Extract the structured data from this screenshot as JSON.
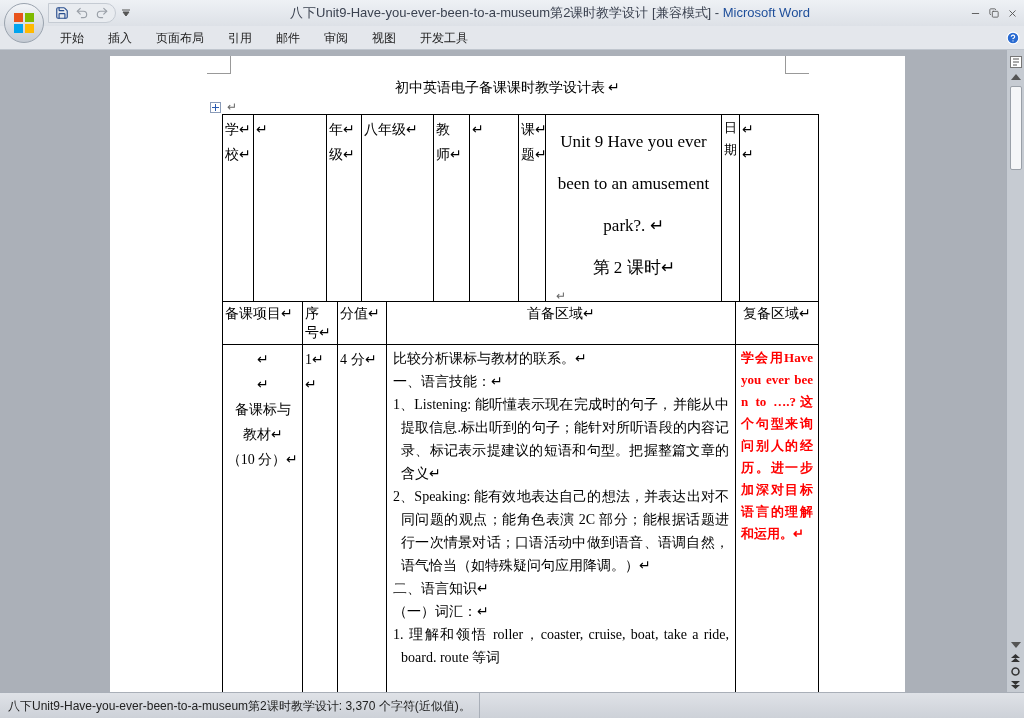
{
  "window": {
    "title": "八下Unit9-Have-you-ever-been-to-a-museum第2课时教学设计 [兼容模式] - ",
    "app_name": "Microsoft Word"
  },
  "ribbon_tabs": [
    "开始",
    "插入",
    "页面布局",
    "引用",
    "邮件",
    "审阅",
    "视图",
    "开发工具"
  ],
  "document": {
    "heading": "初中英语电子备课课时教学设计表 ↵",
    "table_anchor": "↵",
    "row_1": [
      {
        "lines": [
          "学↵",
          "校↵"
        ]
      },
      {
        "lines": [
          "↵"
        ]
      },
      {
        "lines": [
          "年↵",
          "级↵"
        ]
      },
      {
        "lines": [
          "八年级↵"
        ]
      },
      {
        "lines": [
          "教",
          "师↵"
        ]
      },
      {
        "lines": [
          "↵"
        ]
      },
      {
        "lines": [
          "课↵",
          "题↵"
        ]
      },
      {
        "lines": [
          "Unit 9 Have you ever been to an amusement park?. ↵",
          "第 2 课时↵",
          "↵"
        ]
      },
      {
        "lines": [
          "日",
          "期"
        ]
      },
      {
        "lines": [
          "↵",
          "↵"
        ]
      }
    ],
    "row_2": [
      {
        "lines": [
          "备课项目↵"
        ]
      },
      {
        "lines": [
          "序",
          "号↵"
        ]
      },
      {
        "lines": [
          "分值↵"
        ]
      },
      {
        "lines": [
          "首备区域↵"
        ]
      },
      {
        "lines": [
          "复备区域↵"
        ]
      }
    ],
    "row_3": {
      "item": [
        "↵",
        "↵",
        "备课标与",
        "教材↵",
        "（10 分）↵"
      ],
      "number": [
        "1↵",
        "↵"
      ],
      "score": [
        "4 分↵"
      ],
      "paragraphs": [
        "比较分析课标与教材的联系。↵",
        "一、语言技能：↵",
        "1、Listening: 能听懂表示现在完成时的句子，并能从中提取信息.标出听到的句子；能针对所听语段的内容记录、标记表示提建议的短语和句型。把握整篇文章的含义↵",
        "2、Speaking: 能有效地表达自己的想法，并表达出对不同问题的观点；能角色表演 2C 部分；能根据话题进行一次情景对话；口语活动中做到语音、语调自然，语气恰当（如特殊疑问句应用降调。）↵",
        "二、语言知识↵",
        "（一）词汇：↵",
        "1. 理解和领悟 roller，coaster, cruise, boat, take a ride, board. route 等词"
      ],
      "review_note": "学会用Have you ever been to ….?这个句型来询问别人的经历。进一步加深对目标语言的理解和运用。↵"
    }
  },
  "status_bar": {
    "text": "八下Unit9-Have-you-ever-been-to-a-museum第2课时教学设计: 3,370 个字符(近似值)。"
  }
}
